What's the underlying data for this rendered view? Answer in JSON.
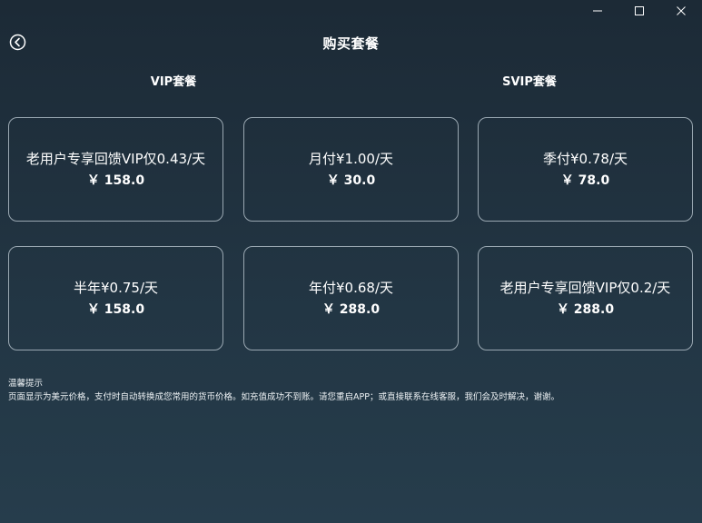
{
  "window": {
    "minimize_icon": "minimize-icon",
    "maximize_icon": "maximize-icon",
    "close_icon": "close-icon"
  },
  "header": {
    "title": "购买套餐",
    "back_icon": "back-arrow-circle-icon"
  },
  "sections": {
    "vip_label": "VIP套餐",
    "svip_label": "SVIP套餐"
  },
  "plans": [
    {
      "name": "老用户专享回馈VIP仅0.43/天",
      "price": "￥ 158.0"
    },
    {
      "name": "月付¥1.00/天",
      "price": "￥ 30.0"
    },
    {
      "name": "季付¥0.78/天",
      "price": "￥ 78.0"
    },
    {
      "name": "半年¥0.75/天",
      "price": "￥ 158.0"
    },
    {
      "name": "年付¥0.68/天",
      "price": "￥ 288.0"
    },
    {
      "name": "老用户专享回馈VIP仅0.2/天",
      "price": "￥ 288.0"
    }
  ],
  "tips": {
    "title": "温馨提示",
    "text": "页面显示为美元价格，支付时自动转换成您常用的货币价格。如充值成功不到账。请您重启APP；或直接联系在线客服，我们会及时解决，谢谢。"
  },
  "colors": {
    "background_top": "#1c2a36",
    "background_bottom": "#263d4c",
    "card_border": "#9aa8b2",
    "text": "#ffffff"
  }
}
